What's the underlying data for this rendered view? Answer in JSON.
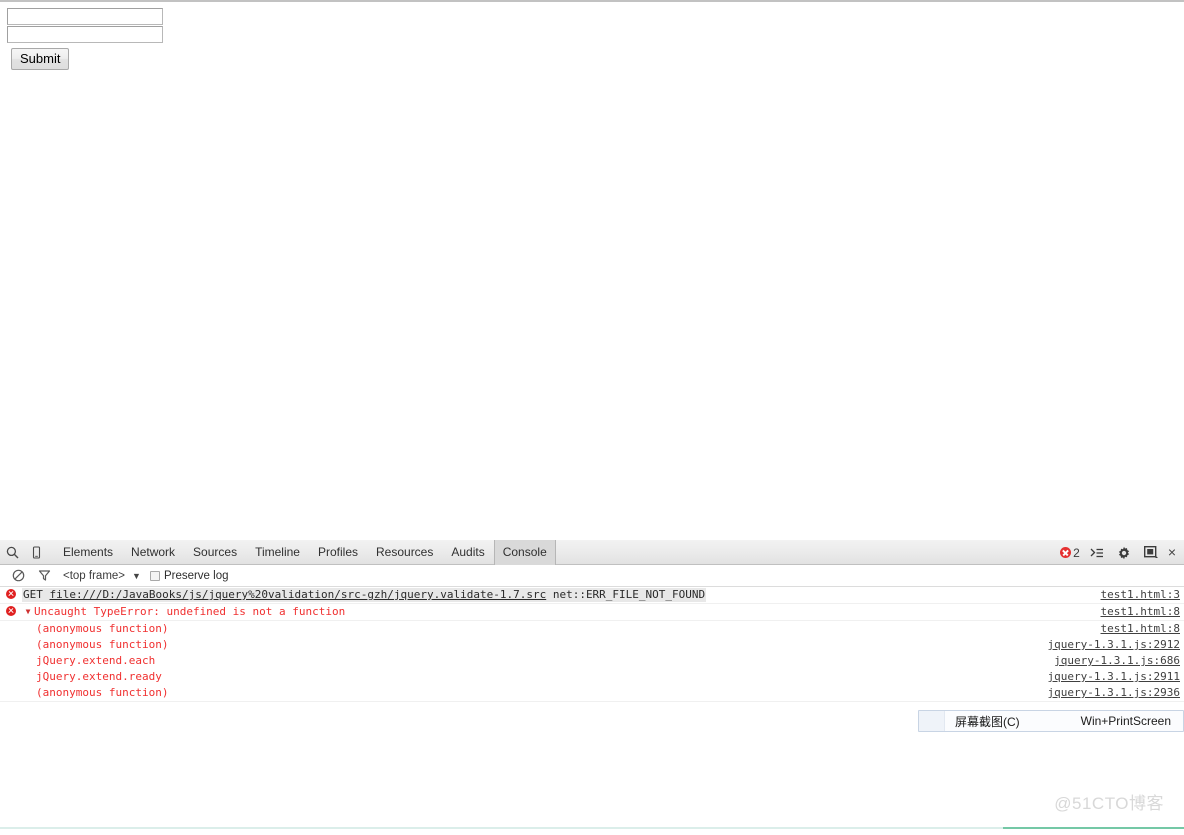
{
  "page": {
    "inputs": [
      {
        "name": "field-1",
        "value": "",
        "placeholder": ""
      },
      {
        "name": "field-2",
        "value": "",
        "placeholder": ""
      }
    ],
    "submit_label": "Submit"
  },
  "devtools": {
    "search_icon": "search-icon",
    "device_icon": "device-toggle-icon",
    "tabs": [
      {
        "label": "Elements",
        "active": false
      },
      {
        "label": "Network",
        "active": false
      },
      {
        "label": "Sources",
        "active": false
      },
      {
        "label": "Timeline",
        "active": false
      },
      {
        "label": "Profiles",
        "active": false
      },
      {
        "label": "Resources",
        "active": false
      },
      {
        "label": "Audits",
        "active": false
      },
      {
        "label": "Console",
        "active": true
      }
    ],
    "error_count": "2",
    "dock_icon": "dock-side-icon",
    "settings_icon": "gear-icon",
    "drawer_icon": "show-drawer-icon",
    "close_label": "×",
    "filter_bar": {
      "clear_icon": "clear-console-icon",
      "filter_icon": "filter-funnel-icon",
      "frame_selector": "<top frame>",
      "frame_caret": "▼",
      "preserve_log_label": "Preserve log",
      "preserve_log_checked": false
    },
    "messages": [
      {
        "type": "network-error",
        "icon": "error-icon",
        "prefix": "GET ",
        "url": "file:///D:/JavaBooks/js/jquery%20validation/src-gzh/jquery.validate-1.7.src",
        "suffix": " net::ERR_FILE_NOT_FOUND",
        "source": "test1.html:3"
      },
      {
        "type": "js-error",
        "icon": "error-icon",
        "disclosure": "▼",
        "text": "Uncaught TypeError: undefined is not a function",
        "source": "test1.html:8"
      },
      {
        "type": "trace",
        "text": "(anonymous function)",
        "source": "test1.html:8"
      },
      {
        "type": "trace",
        "text": "(anonymous function)",
        "source": "jquery-1.3.1.js:2912"
      },
      {
        "type": "trace",
        "text": "jQuery.extend.each",
        "source": "jquery-1.3.1.js:686"
      },
      {
        "type": "trace",
        "text": "jQuery.extend.ready",
        "source": "jquery-1.3.1.js:2911"
      },
      {
        "type": "trace",
        "text": "(anonymous function)",
        "source": "jquery-1.3.1.js:2936"
      }
    ],
    "prompt_caret": "›"
  },
  "screenshot_popup": {
    "label": "屏幕截图(C)",
    "shortcut": "Win+PrintScreen"
  },
  "watermark": {
    "text": "@51CTO博客"
  },
  "colors": {
    "error_red": "#f03030",
    "badge_red": "#e02020",
    "accent_green": "#74c8a6",
    "accent_green_pale": "#dbeeea",
    "link_gray": "#404040"
  }
}
